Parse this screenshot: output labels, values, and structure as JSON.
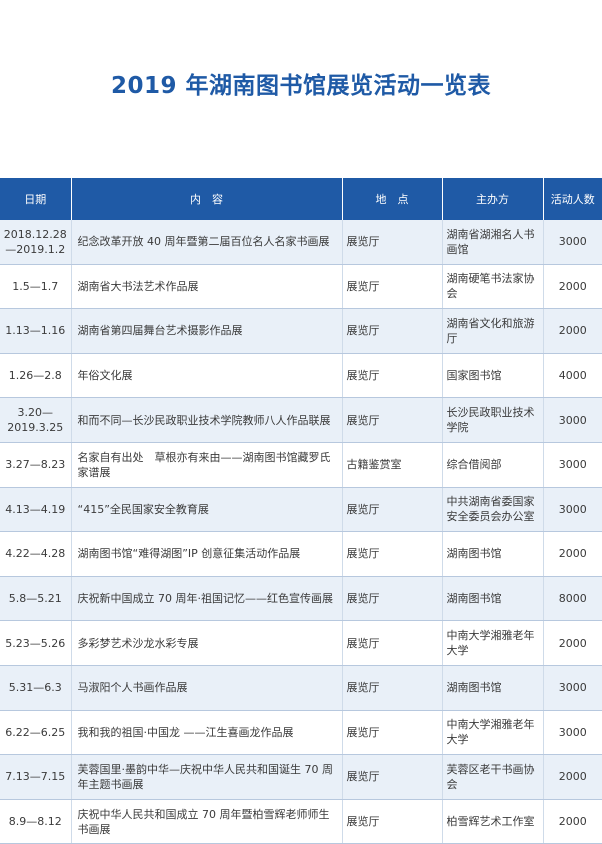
{
  "title": "2019 年湖南图书馆展览活动一览表",
  "headers": {
    "date": "日期",
    "content": "内　容",
    "place": "地　点",
    "organizer": "主办方",
    "count": "活动人数"
  },
  "rows": [
    {
      "date": "2018.12.28\n—2019.1.2",
      "content": "纪念改革开放 40 周年暨第二届百位名人名家书画展",
      "place": "展览厅",
      "organizer": "湖南省湖湘名人书画馆",
      "count": "3000"
    },
    {
      "date": "1.5—1.7",
      "content": "湖南省大书法艺术作品展",
      "place": "展览厅",
      "organizer": "湖南硬笔书法家协会",
      "count": "2000"
    },
    {
      "date": "1.13—1.16",
      "content": "湖南省第四届舞台艺术摄影作品展",
      "place": "展览厅",
      "organizer": "湖南省文化和旅游厅",
      "count": "2000"
    },
    {
      "date": "1.26—2.8",
      "content": "年俗文化展",
      "place": "展览厅",
      "organizer": "国家图书馆",
      "count": "4000"
    },
    {
      "date": "3.20—\n2019.3.25",
      "content": "和而不同—长沙民政职业技术学院教师八人作品联展",
      "place": "展览厅",
      "organizer": "长沙民政职业技术学院",
      "count": "3000"
    },
    {
      "date": "3.27—8.23",
      "content": "名家自有出处　草根亦有来由——湖南图书馆藏罗氏家谱展",
      "place": "古籍鉴赏室",
      "organizer": "综合借阅部",
      "count": "3000"
    },
    {
      "date": "4.13—4.19",
      "content": "“415”全民国家安全教育展",
      "place": "展览厅",
      "organizer": "中共湖南省委国家安全委员会办公室",
      "count": "3000"
    },
    {
      "date": "4.22—4.28",
      "content": "湖南图书馆“难得湖图”IP 创意征集活动作品展",
      "place": "展览厅",
      "organizer": "湖南图书馆",
      "count": "2000"
    },
    {
      "date": "5.8—5.21",
      "content": "庆祝新中国成立 70 周年·祖国记忆——红色宣传画展",
      "place": "展览厅",
      "organizer": "湖南图书馆",
      "count": "8000"
    },
    {
      "date": "5.23—5.26",
      "content": "多彩梦艺术沙龙水彩专展",
      "place": "展览厅",
      "organizer": "中南大学湘雅老年大学",
      "count": "2000"
    },
    {
      "date": "5.31—6.3",
      "content": "马淑阳个人书画作品展",
      "place": "展览厅",
      "organizer": "湖南图书馆",
      "count": "3000"
    },
    {
      "date": "6.22—6.25",
      "content": "我和我的祖国·中国龙 ——江生喜画龙作品展",
      "place": "展览厅",
      "organizer": "中南大学湘雅老年大学",
      "count": "3000"
    },
    {
      "date": "7.13—7.15",
      "content": "芙蓉国里·墨韵中华—庆祝中华人民共和国诞生 70 周年主题书画展",
      "place": "展览厅",
      "organizer": "芙蓉区老干书画协会",
      "count": "2000"
    },
    {
      "date": "8.9—8.12",
      "content": "庆祝中华人民共和国成立 70 周年暨柏雪辉老师师生书画展",
      "place": "展览厅",
      "organizer": "柏雪辉艺术工作室",
      "count": "2000"
    }
  ]
}
